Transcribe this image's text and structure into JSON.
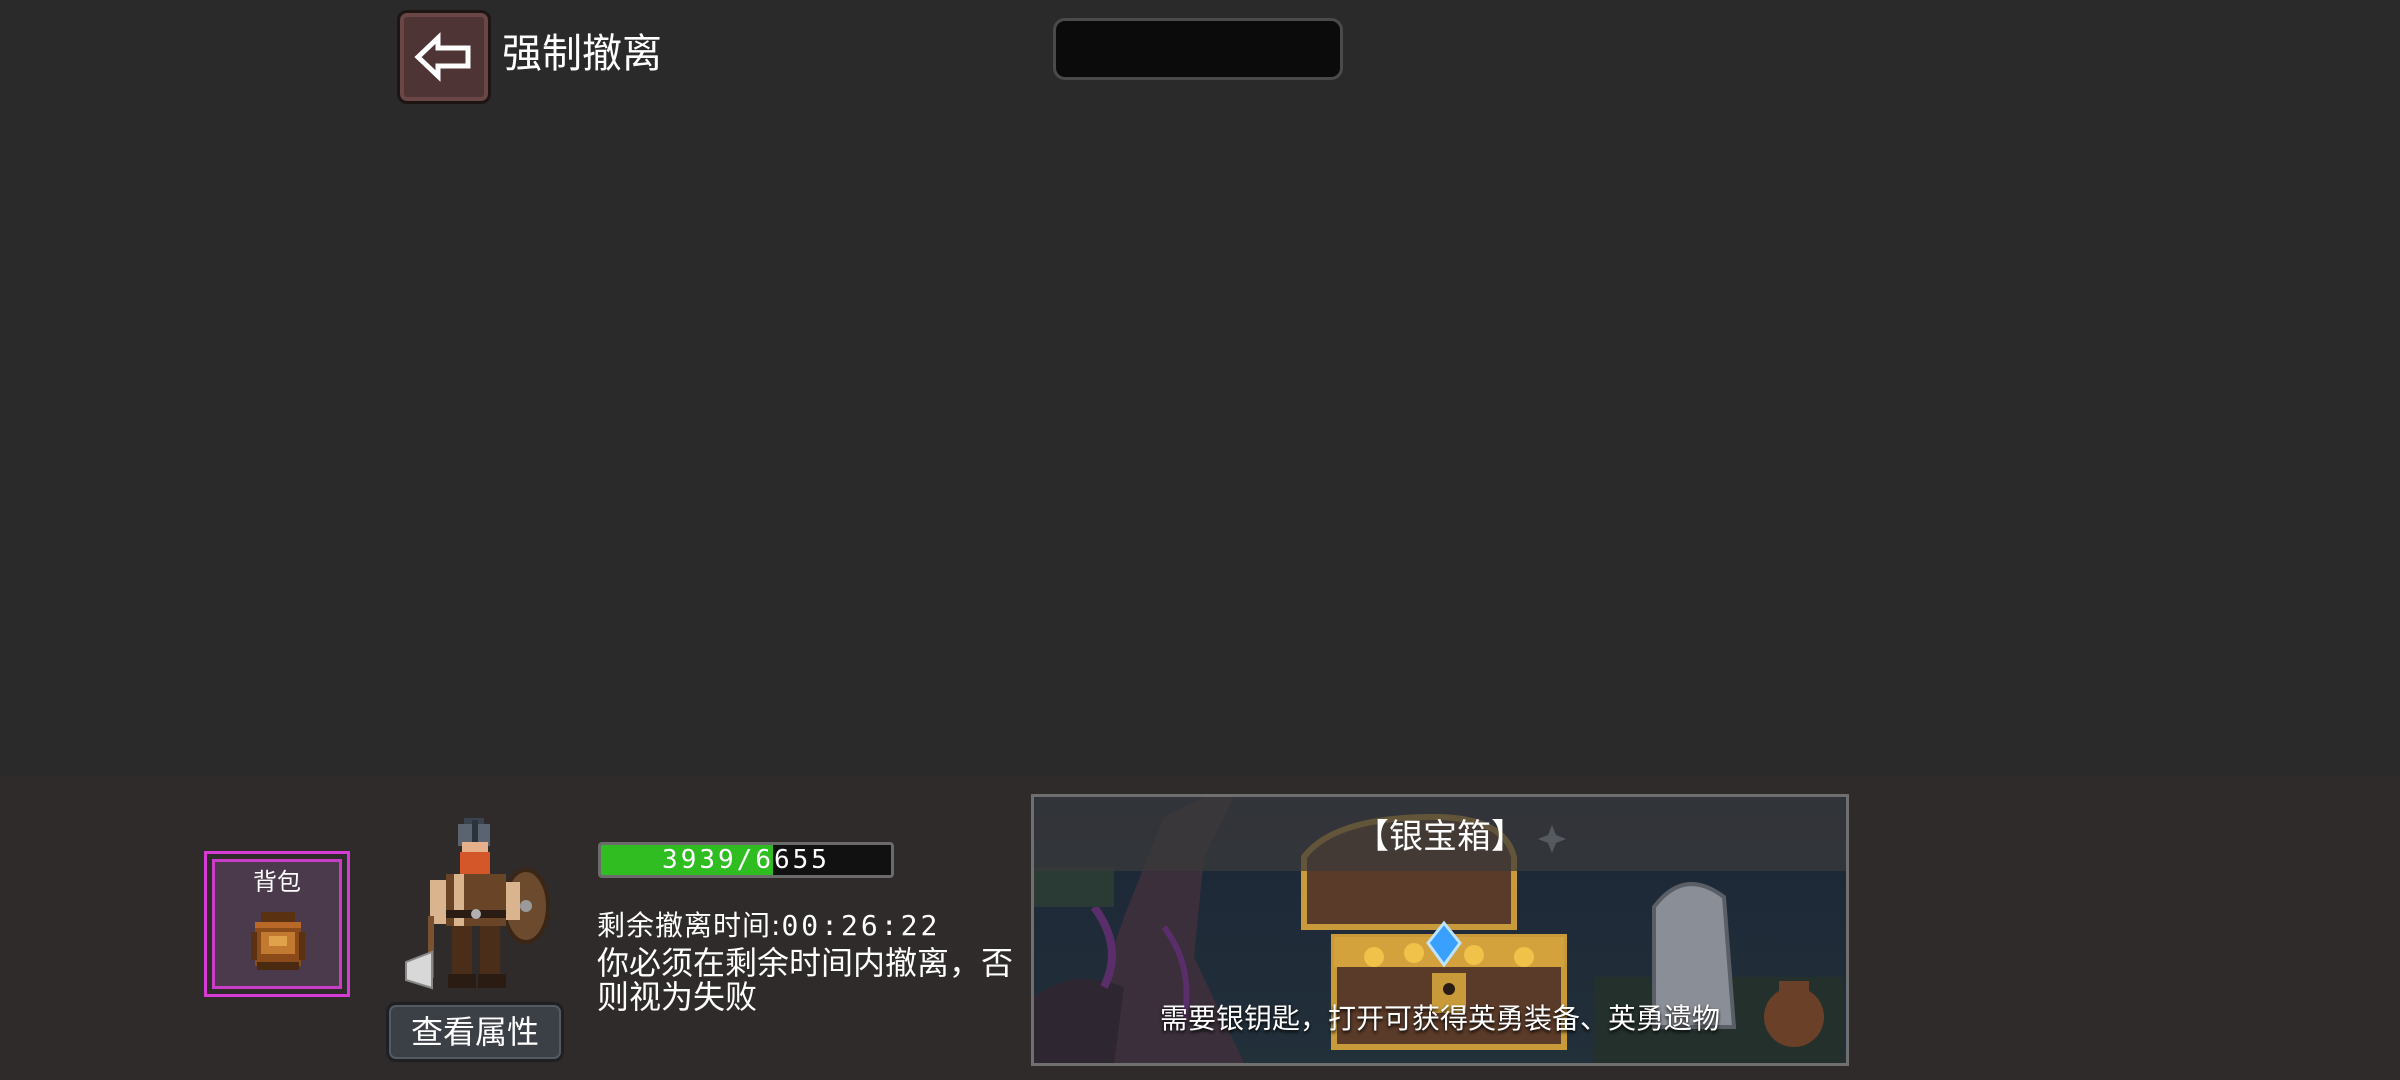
{
  "top": {
    "back_icon": "left-arrow-icon",
    "force_evacuate_label": "强制撤离"
  },
  "player": {
    "bag_label": "背包",
    "bag_icon": "backpack-icon",
    "hp_text": "3939/6655",
    "hp_current": 3939,
    "hp_max": 6655,
    "timer_label": "剩余撤离时间:",
    "timer_value": "00:26:22",
    "warning": "你必须在剩余时间内撤离，否则视为失败",
    "stats_button": "查看属性"
  },
  "chest": {
    "title": "【银宝箱】",
    "description": "需要银钥匙，打开可获得英勇装备、英勇遗物"
  },
  "colors": {
    "background": "#2a2a2a",
    "hp_fill": "#2fbd22",
    "bag_border": "#d63bd6"
  }
}
